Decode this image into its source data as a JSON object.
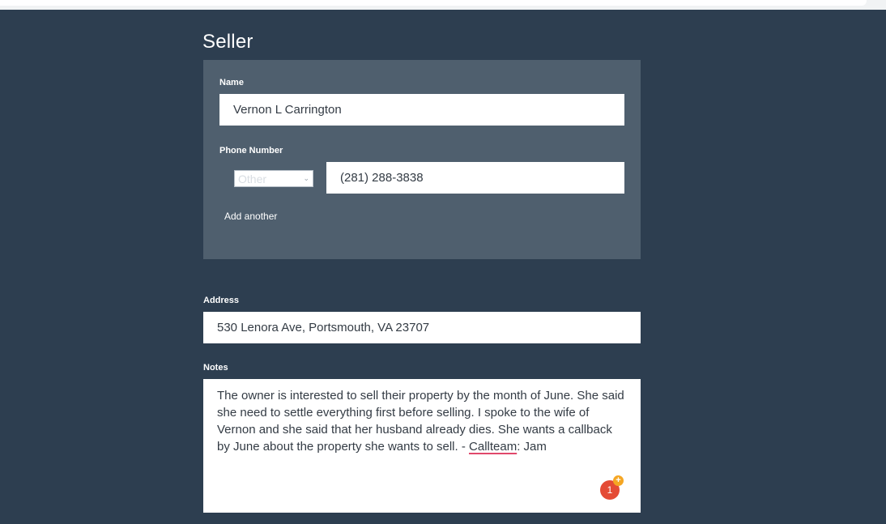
{
  "seller": {
    "title": "Seller",
    "name_label": "Name",
    "name_value": "Vernon L Carrington",
    "phone_label": "Phone Number",
    "phone_type_selected": "Other",
    "phone_value": "(281) 288-3838",
    "add_another": "Add another"
  },
  "address": {
    "label": "Address",
    "value": "530 Lenora Ave, Portsmouth, VA 23707"
  },
  "notes": {
    "label": "Notes",
    "text_before": "The owner is interested to sell their property by the month of June. She said she need to settle everything first before selling. I spoke to the wife of Vernon and she said that her husband already dies. She wants a callback by June about the property she wants to sell. - ",
    "flagged_word": "Callteam",
    "text_after": ": Jam"
  },
  "badge": {
    "count": "1",
    "plus": "+"
  }
}
